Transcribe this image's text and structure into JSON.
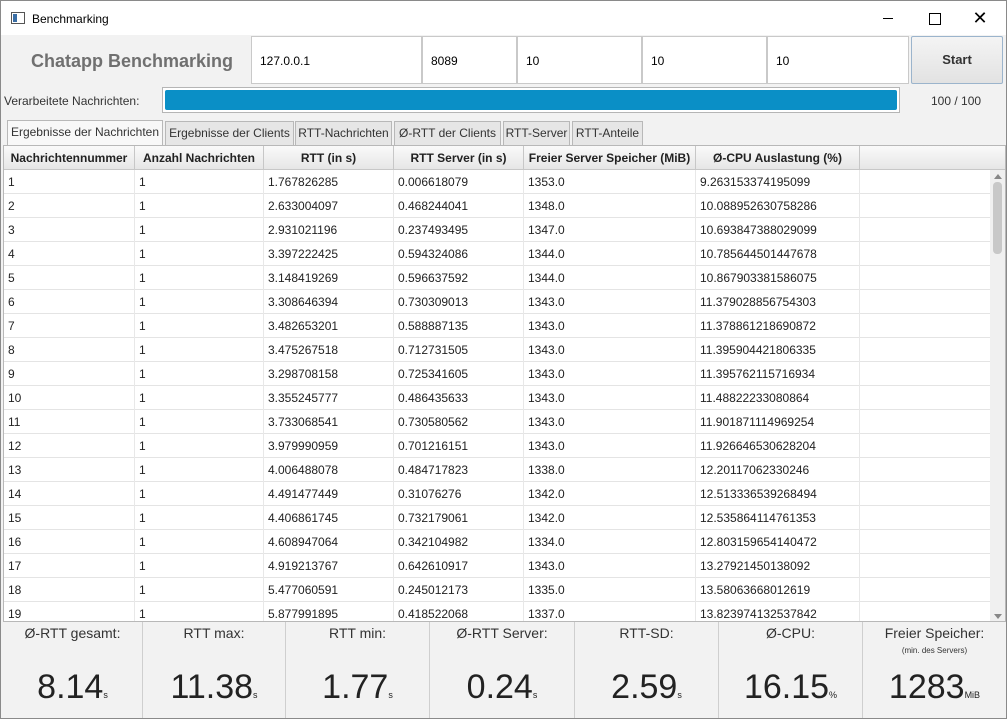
{
  "window": {
    "title": "Benchmarking"
  },
  "header": {
    "heading": "Chatapp Benchmarking",
    "fields": [
      "127.0.0.1",
      "8089",
      "10",
      "10",
      "10"
    ],
    "start_label": "Start"
  },
  "progress": {
    "label": "Verarbeitete Nachrichten:",
    "count_text": "100 / 100",
    "fraction": 1.0,
    "color": "#0a8fc6"
  },
  "tabs": [
    {
      "label": "Ergebnisse der Nachrichten",
      "active": true
    },
    {
      "label": "Ergebnisse der Clients",
      "active": false
    },
    {
      "label": "RTT-Nachrichten",
      "active": false
    },
    {
      "label": "Ø-RTT der Clients",
      "active": false
    },
    {
      "label": "RTT-Server",
      "active": false
    },
    {
      "label": "RTT-Anteile",
      "active": false
    }
  ],
  "table": {
    "columns": [
      "Nachrichtennummer",
      "Anzahl Nachrichten",
      "RTT (in s)",
      "RTT Server (in s)",
      "Freier Server Speicher (MiB)",
      "Ø-CPU Auslastung (%)"
    ],
    "rows": [
      [
        "1",
        "1",
        "1.767826285",
        "0.006618079",
        "1353.0",
        "9.263153374195099"
      ],
      [
        "2",
        "1",
        "2.633004097",
        "0.468244041",
        "1348.0",
        "10.088952630758286"
      ],
      [
        "3",
        "1",
        "2.931021196",
        "0.237493495",
        "1347.0",
        "10.693847388029099"
      ],
      [
        "4",
        "1",
        "3.397222425",
        "0.594324086",
        "1344.0",
        "10.785644501447678"
      ],
      [
        "5",
        "1",
        "3.148419269",
        "0.596637592",
        "1344.0",
        "10.867903381586075"
      ],
      [
        "6",
        "1",
        "3.308646394",
        "0.730309013",
        "1343.0",
        "11.379028856754303"
      ],
      [
        "7",
        "1",
        "3.482653201",
        "0.588887135",
        "1343.0",
        "11.378861218690872"
      ],
      [
        "8",
        "1",
        "3.475267518",
        "0.712731505",
        "1343.0",
        "11.395904421806335"
      ],
      [
        "9",
        "1",
        "3.298708158",
        "0.725341605",
        "1343.0",
        "11.395762115716934"
      ],
      [
        "10",
        "1",
        "3.355245777",
        "0.486435633",
        "1343.0",
        "11.48822233080864"
      ],
      [
        "11",
        "1",
        "3.733068541",
        "0.730580562",
        "1343.0",
        "11.901871114969254"
      ],
      [
        "12",
        "1",
        "3.979990959",
        "0.701216151",
        "1343.0",
        "11.926646530628204"
      ],
      [
        "13",
        "1",
        "4.006488078",
        "0.484717823",
        "1338.0",
        "12.20117062330246"
      ],
      [
        "14",
        "1",
        "4.491477449",
        "0.31076276",
        "1342.0",
        "12.513336539268494"
      ],
      [
        "15",
        "1",
        "4.406861745",
        "0.732179061",
        "1342.0",
        "12.535864114761353"
      ],
      [
        "16",
        "1",
        "4.608947064",
        "0.342104982",
        "1334.0",
        "12.803159654140472"
      ],
      [
        "17",
        "1",
        "4.919213767",
        "0.642610917",
        "1343.0",
        "13.27921450138092"
      ],
      [
        "18",
        "1",
        "5.477060591",
        "0.245012173",
        "1335.0",
        "13.58063668012619"
      ],
      [
        "19",
        "1",
        "5.877991895",
        "0.418522068",
        "1337.0",
        "13.823974132537842"
      ]
    ]
  },
  "stats": [
    {
      "label": "Ø-RTT gesamt:",
      "sub": "",
      "value": "8.14",
      "unit": "s"
    },
    {
      "label": "RTT max:",
      "sub": "",
      "value": "11.38",
      "unit": "s"
    },
    {
      "label": "RTT min:",
      "sub": "",
      "value": "1.77",
      "unit": "s"
    },
    {
      "label": "Ø-RTT Server:",
      "sub": "",
      "value": "0.24",
      "unit": "s"
    },
    {
      "label": "RTT-SD:",
      "sub": "",
      "value": "2.59",
      "unit": "s"
    },
    {
      "label": "Ø-CPU:",
      "sub": "",
      "value": "16.15",
      "unit": "%"
    },
    {
      "label": "Freier Speicher:",
      "sub": "(min. des Servers)",
      "value": "1283",
      "unit": "MiB"
    }
  ]
}
